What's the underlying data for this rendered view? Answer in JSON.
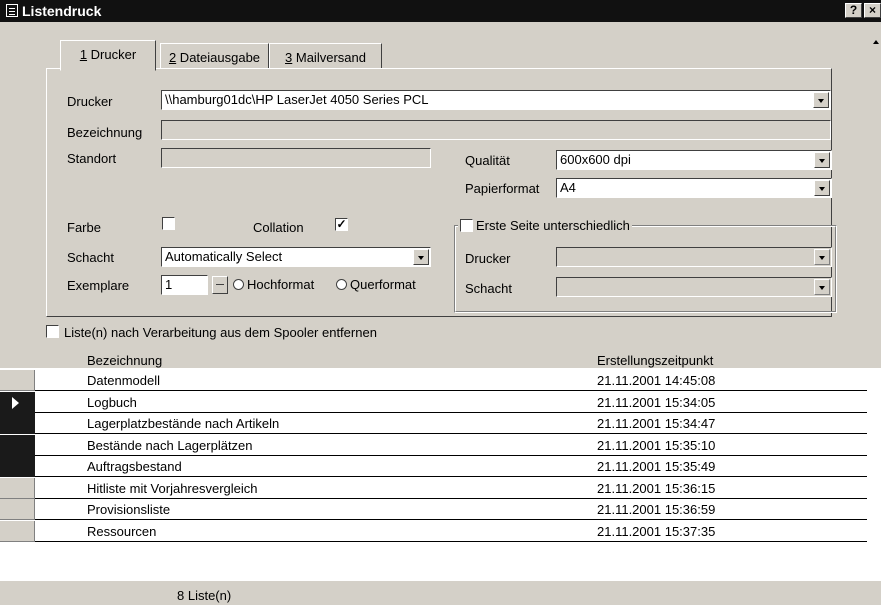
{
  "window": {
    "title": "Listendruck",
    "help_label": "?",
    "close_label": "×"
  },
  "tabs": [
    {
      "key": "1",
      "rest": " Drucker"
    },
    {
      "key": "2",
      "rest": " Dateiausgabe"
    },
    {
      "key": "3",
      "rest": " Mailversand"
    }
  ],
  "form": {
    "drucker_label": "Drucker",
    "drucker_value": "\\\\hamburg01dc\\HP LaserJet 4050 Series PCL",
    "bezeichnung_label": "Bezeichnung",
    "bezeichnung_value": "",
    "standort_label": "Standort",
    "standort_value": "",
    "qualitaet_label": "Qualität",
    "qualitaet_value": "600x600 dpi",
    "papierformat_label": "Papierformat",
    "papierformat_value": "A4",
    "farbe_label": "Farbe",
    "farbe_checked": false,
    "collation_label": "Collation",
    "collation_checked": true,
    "check_mark": "✓",
    "schacht_label": "Schacht",
    "schacht_value": "Automatically Select",
    "exemplare_label": "Exemplare",
    "exemplare_value": "1",
    "hochformat_label": "Hochformat",
    "querformat_label": "Querformat",
    "erste_seite_label": "Erste Seite unterschiedlich",
    "erste_seite_checked": false,
    "drucker2_label": "Drucker",
    "schacht2_label": "Schacht"
  },
  "remove_spooler_label": "Liste(n) nach Verarbeitung aus dem Spooler entfernen",
  "list": {
    "columns": [
      "Bezeichnung",
      "Erstellungszeitpunkt"
    ],
    "rows": [
      {
        "name": "Datenmodell",
        "time": "21.11.2001 14:45:08",
        "selector": "none"
      },
      {
        "name": "Logbuch",
        "time": "21.11.2001 15:34:05",
        "selector": "current"
      },
      {
        "name": "Lagerplatzbestände nach Artikeln",
        "time": "21.11.2001 15:34:47",
        "selector": "selected"
      },
      {
        "name": "Bestände nach Lagerplätzen",
        "time": "21.11.2001 15:35:10",
        "selector": "selected"
      },
      {
        "name": "Auftragsbestand",
        "time": "21.11.2001 15:35:49",
        "selector": "selected"
      },
      {
        "name": "Hitliste mit Vorjahresvergleich",
        "time": "21.11.2001 15:36:15",
        "selector": "none"
      },
      {
        "name": "Provisionsliste",
        "time": "21.11.2001 15:36:59",
        "selector": "none"
      },
      {
        "name": "Ressourcen",
        "time": "21.11.2001 15:37:35",
        "selector": "none"
      }
    ]
  },
  "footer": {
    "count_label": "8 Liste(n)"
  },
  "colors": {
    "dialog_bg": "#d4d0c8",
    "titlebar": "#111111",
    "selected_row_marker": "#1a1a1a"
  }
}
